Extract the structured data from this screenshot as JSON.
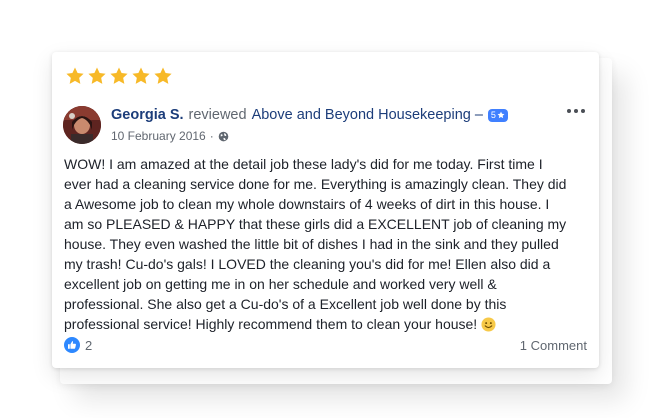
{
  "review": {
    "rating": 5,
    "author": "Georgia S.",
    "action": "reviewed",
    "page_name": "Above and Beyond Housekeeping",
    "dash": "–",
    "badge_value": "5",
    "badge_icon": "star-icon",
    "date": "10 February 2016",
    "separator": "·",
    "privacy_icon": "globe-icon",
    "more_icon": "more-options-icon",
    "text_lines": [
      "WOW! I am amazed at the detail job these lady's did for me today. First time I",
      "ever had a cleaning service done for me. Everything is amazingly clean. They did",
      "a Awesome job to clean my whole downstairs of 4 weeks of dirt in this house. I",
      "am so PLEASED & HAPPY that these girls did a EXCELLENT job of cleaning my",
      "house. They even washed the little bit of dishes I had in the sink and they pulled",
      "my trash! Cu-do's gals! I LOVED the cleaning you's did for me! Ellen also did a",
      "excellent job on getting me in on her schedule and worked very well &",
      "professional. She also get a Cu-do's of a Excellent job well done by this",
      "professional service! Highly recommend them to clean your house!"
    ],
    "emoji": "smiley-emoji",
    "likes_count": "2",
    "comments_label": "1 Comment"
  },
  "colors": {
    "star": "#f7b928",
    "link": "#1c3d7a",
    "badge": "#4080ff",
    "like": "#2d88ff",
    "text": "#1d2129",
    "muted": "#606770"
  }
}
